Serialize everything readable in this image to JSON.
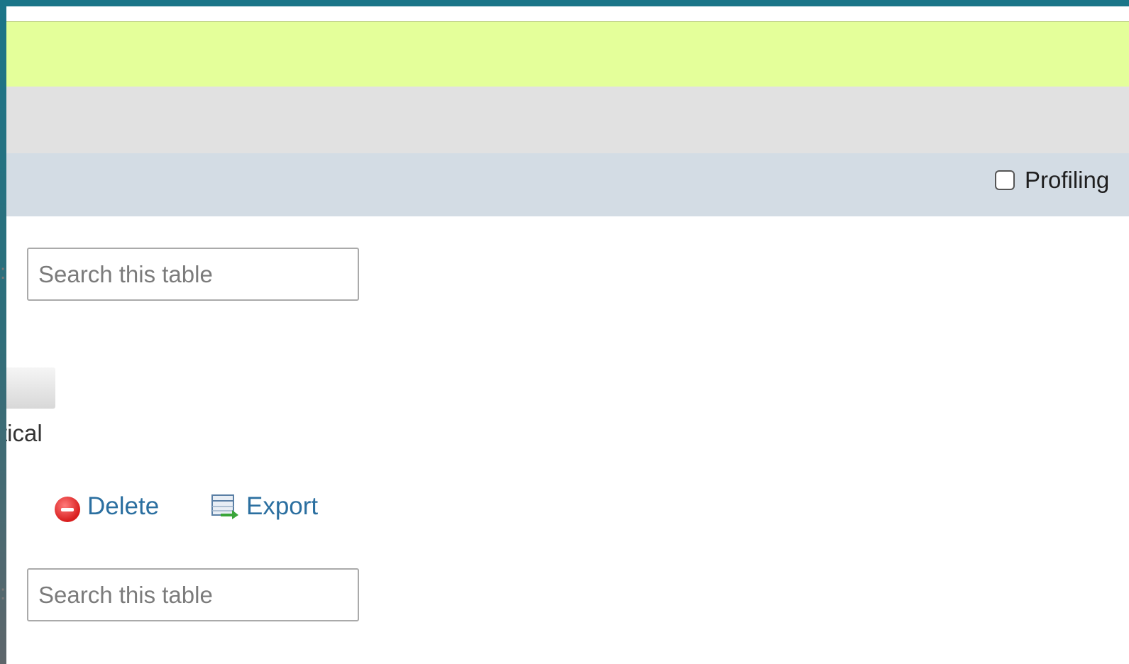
{
  "header": {
    "profiling_label": "Profiling",
    "profiling_checked": false
  },
  "filters": {
    "top": {
      "label": ":",
      "placeholder": "Search this table"
    },
    "bottom": {
      "label": ":",
      "placeholder": "Search this table"
    }
  },
  "view": {
    "label": "tical"
  },
  "actions": {
    "delete_label": "Delete",
    "export_label": "Export"
  },
  "colors": {
    "frame": "#1b7588",
    "green_bar": "#e4ff9a",
    "gray_bar": "#e1e1e1",
    "blue_bar": "#d3dce4",
    "link": "#2b6fa0"
  },
  "icons": [
    "delete-icon",
    "export-icon"
  ]
}
